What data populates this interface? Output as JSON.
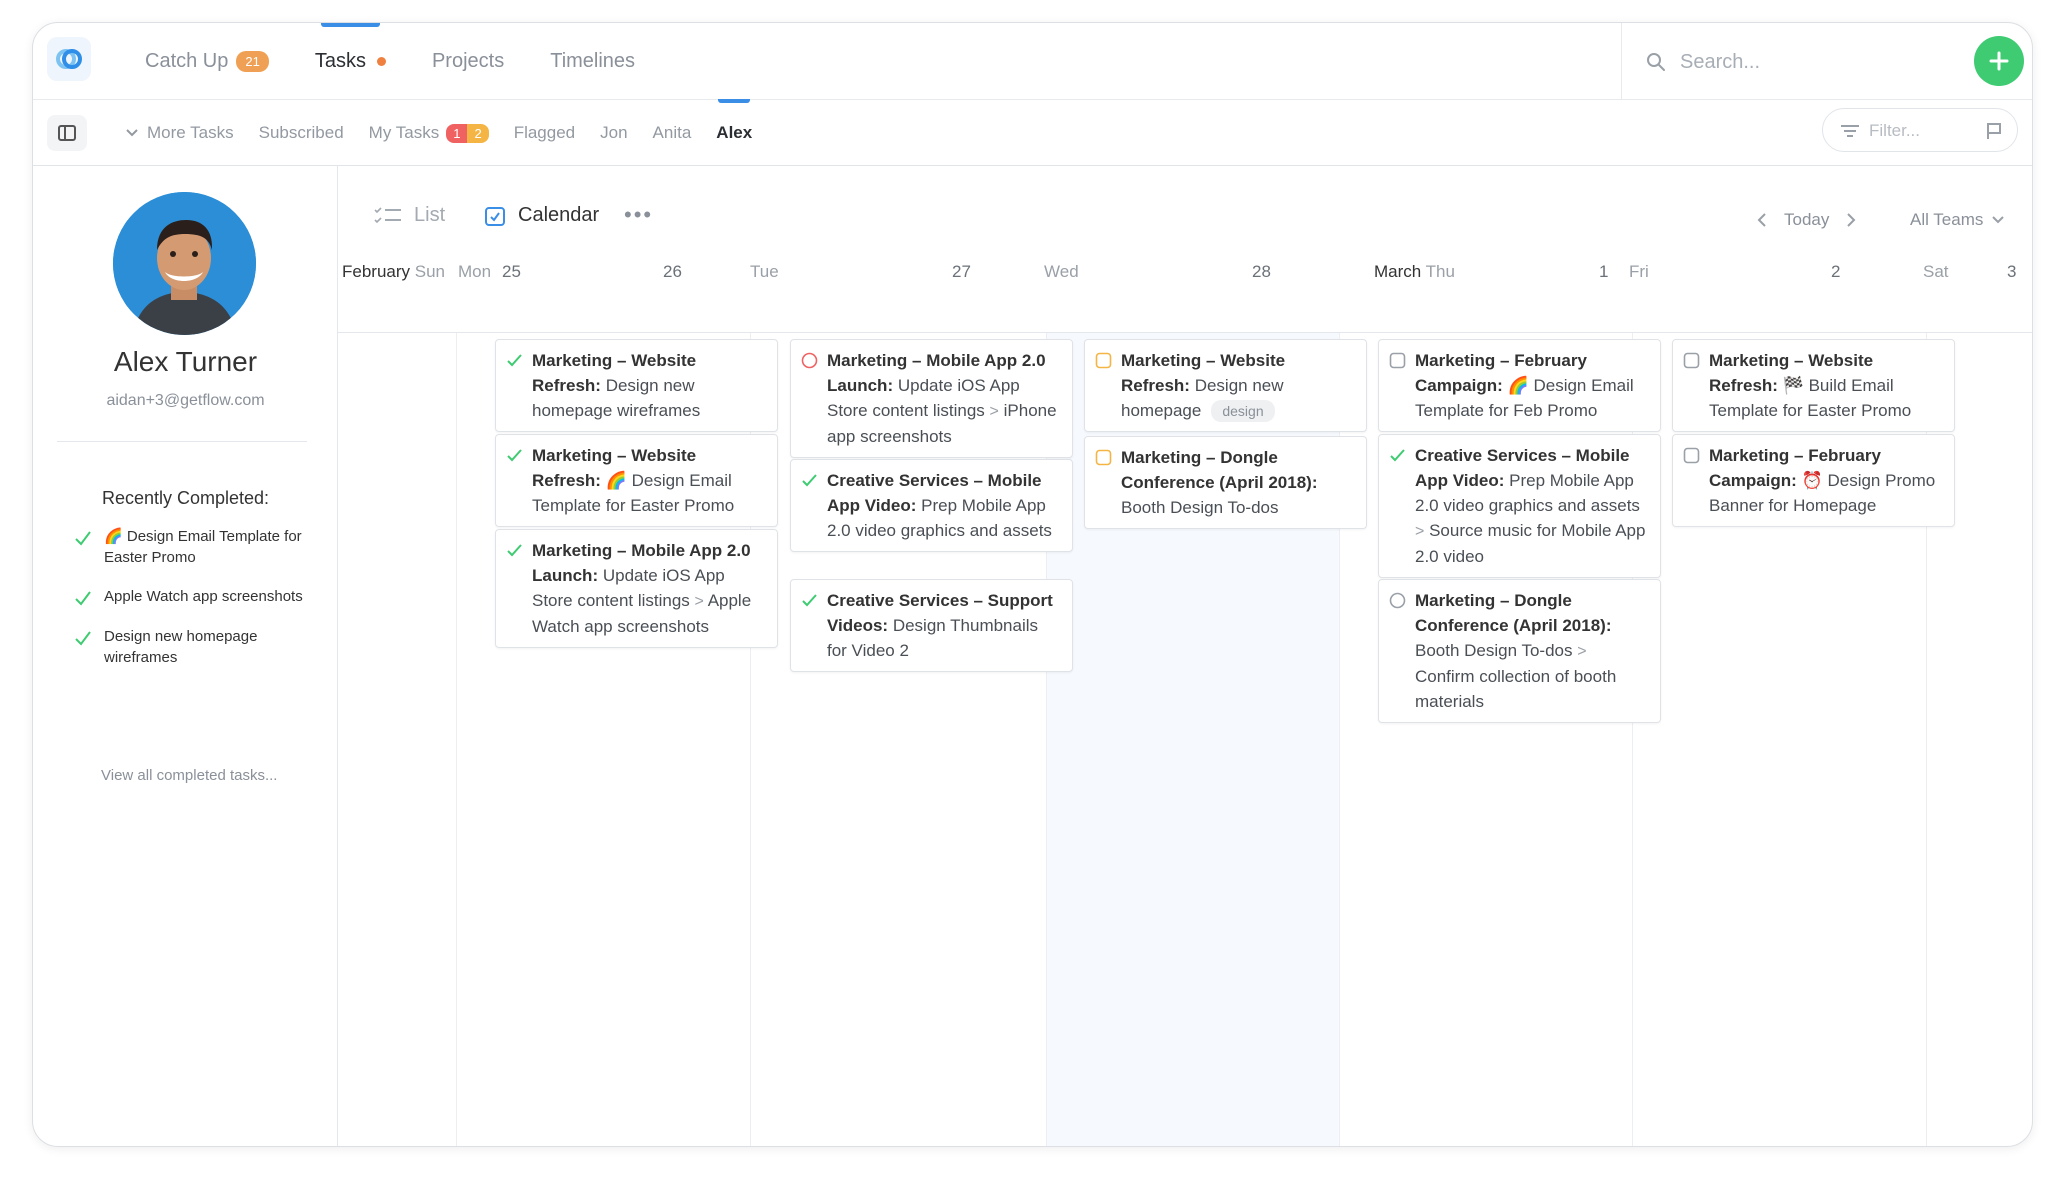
{
  "nav": {
    "items": [
      {
        "label": "Catch Up",
        "badge": "21"
      },
      {
        "label": "Tasks"
      },
      {
        "label": "Projects"
      },
      {
        "label": "Timelines"
      }
    ],
    "search_placeholder": "Search..."
  },
  "subnav": {
    "more_tasks": "More Tasks",
    "subscribed": "Subscribed",
    "my_tasks": "My Tasks",
    "my_tasks_red": "1",
    "my_tasks_yellow": "2",
    "flagged": "Flagged",
    "jon": "Jon",
    "anita": "Anita",
    "alex": "Alex",
    "filter_placeholder": "Filter..."
  },
  "profile": {
    "name": "Alex Turner",
    "email": "aidan+3@getflow.com",
    "recently_completed_title": "Recently Completed:",
    "recently_completed": [
      {
        "emoji": "🌈",
        "text": "Design Email Template for Easter Promo"
      },
      {
        "emoji": "",
        "text": "Apple Watch app screenshots"
      },
      {
        "emoji": "",
        "text": "Design new homepage wireframes"
      }
    ],
    "view_all": "View all completed tasks..."
  },
  "toolbar": {
    "list": "List",
    "calendar": "Calendar",
    "more": "•••",
    "today": "Today",
    "all_teams": "All Teams"
  },
  "days": {
    "feb_month": "February",
    "sun": "Sun",
    "mon": "Mon",
    "d25": "25",
    "d26": "26",
    "tue": "Tue",
    "d27": "27",
    "wed": "Wed",
    "d28": "28",
    "mar_month": "March",
    "thu": "Thu",
    "d1": "1",
    "fri": "Fri",
    "d2": "2",
    "sat": "Sat",
    "d3": "3"
  },
  "cards": {
    "mon1": {
      "bold": "Marketing – Website Refresh:",
      "text": " Design new homepage wireframes"
    },
    "mon2": {
      "bold": "Marketing – Website Refresh:",
      "emoji": " 🌈 ",
      "text": " Design Email Template for Easter Promo"
    },
    "mon3": {
      "bold": "Marketing – Mobile App 2.0 Launch:",
      "text": " Update iOS App Store content listings",
      "sub": "Apple Watch app screenshots"
    },
    "tue1": {
      "bold": "Marketing – Mobile App 2.0 Launch:",
      "text": " Update iOS App Store content listings",
      "sub": "iPhone app screenshots"
    },
    "tue2": {
      "bold": "Creative Services – Mobile App Video:",
      "text": " Prep Mobile App 2.0 video graphics and assets"
    },
    "tue3": {
      "bold": "Creative Services – Support Videos:",
      "text": " Design Thumbnails for Video 2"
    },
    "wed1": {
      "bold": "Marketing – Website Refresh:",
      "text": " Design new homepage",
      "tag": "design"
    },
    "wed2": {
      "bold": "Marketing – Dongle Conference (April 2018):",
      "text": " Booth Design To-dos"
    },
    "thu1": {
      "bold": "Marketing – February Campaign:",
      "emoji": " 🌈 ",
      "text": " Design Email Template for Feb Promo"
    },
    "thu2": {
      "bold": "Creative Services – Mobile App Video:",
      "text": " Prep Mobile App 2.0 video graphics and assets",
      "sub": "Source music for Mobile App 2.0 video"
    },
    "thu3": {
      "bold": "Marketing – Dongle Conference (April 2018):",
      "text": " Booth Design To-dos",
      "sub": "Confirm collection of booth materials"
    },
    "fri1": {
      "bold": "Marketing – Website Refresh:",
      "emoji": " 🏁 ",
      "text": " Build Email Template for Easter Promo"
    },
    "fri2": {
      "bold": "Marketing – February Campaign:",
      "emoji": " ⏰ ",
      "text": " Design Promo Banner for Homepage"
    }
  },
  "colors": {
    "accent_blue": "#3a8ee6",
    "green": "#3ecb72",
    "orange": "#f0a055",
    "red": "#f06262",
    "yellow": "#f4b545"
  }
}
